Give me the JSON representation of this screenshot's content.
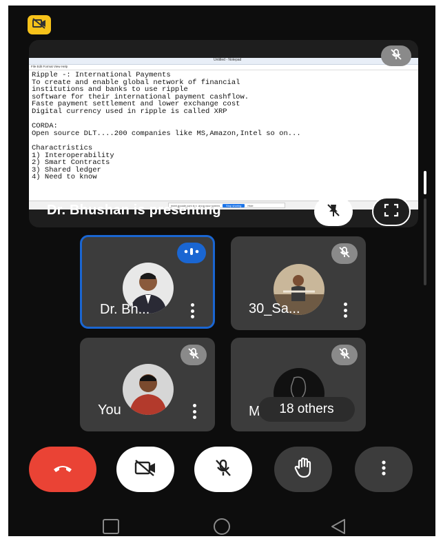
{
  "presentation": {
    "notepad_title": "Untitled - Notepad",
    "notepad_menu": "File  Edit  Format  View  Help",
    "notepad_lines": [
      "Ripple -: International Payments",
      "To create and enable global network of financial",
      "institutions and banks to use ripple",
      "software for their international payment cashflow.",
      "Faste payment settlement and lower exchange cost",
      "Digital currency used in ripple is called XRP",
      "",
      "CORDA:",
      "Open source DLT....200 companies like MS,Amazon,Intel so on...",
      "",
      "Charactristics",
      "1) Interoperability",
      "2) Smart Contracts",
      "3) Shared ledger",
      "4) Need to know"
    ],
    "share_bar_text": "meet.google.com is sharing your screen",
    "share_bar_stop": "Stop sharing",
    "share_bar_hide": "Hide",
    "presenting_label": "Dr. Bhushan is presenting"
  },
  "participants": [
    {
      "name": "Dr. Bh...",
      "state": "speaking"
    },
    {
      "name": "30_Sa...",
      "state": "muted"
    },
    {
      "name": "You",
      "state": "muted"
    },
    {
      "name": "M",
      "state": "muted"
    }
  ],
  "others_label": "18 others",
  "colors": {
    "badge": "#f7c21a",
    "end_call": "#ea4335",
    "active_border": "#1a66d2",
    "speaking": "#1a66d2"
  },
  "icons": {
    "badge": "camera-off-icon",
    "presenter_mute": "mic-off-icon",
    "unpin": "pin-off-icon",
    "fullscreen": "fullscreen-icon",
    "end_call": "phone-hangup-icon",
    "camera": "camera-off-icon",
    "mic": "mic-off-icon",
    "hand": "raise-hand-icon",
    "more": "more-vert-icon"
  }
}
